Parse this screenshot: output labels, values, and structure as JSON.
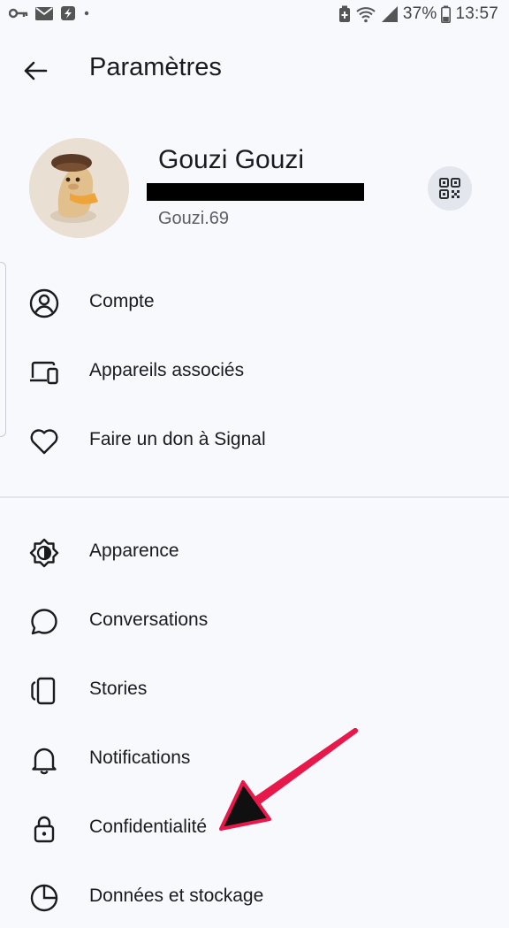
{
  "status_bar": {
    "left_icons": [
      "key-icon",
      "mail-icon",
      "signal-app-icon",
      "dot-icon"
    ],
    "right_icons": [
      "battery-saver-icon",
      "wifi-icon",
      "cell-signal-icon",
      "battery-icon"
    ],
    "battery": "37%",
    "time": "13:57"
  },
  "app_bar": {
    "back_icon": "arrow-left-icon",
    "title": "Paramètres"
  },
  "profile": {
    "name": "Gouzi Gouzi",
    "username": "Gouzi.69",
    "qr_icon": "qr-code-icon"
  },
  "menu_group_1": [
    {
      "label": "Compte",
      "icon": "account-circle-icon"
    },
    {
      "label": "Appareils associés",
      "icon": "linked-devices-icon"
    },
    {
      "label": "Faire un don à Signal",
      "icon": "heart-icon"
    }
  ],
  "menu_group_2": [
    {
      "label": "Apparence",
      "icon": "appearance-icon"
    },
    {
      "label": "Conversations",
      "icon": "chat-bubble-icon"
    },
    {
      "label": "Stories",
      "icon": "stories-icon"
    },
    {
      "label": "Notifications",
      "icon": "bell-icon"
    },
    {
      "label": "Confidentialité",
      "icon": "lock-icon"
    },
    {
      "label": "Données et stockage",
      "icon": "data-storage-icon"
    }
  ],
  "annotation": {
    "color": "#e8184a",
    "shape": "arrow-annotation"
  }
}
